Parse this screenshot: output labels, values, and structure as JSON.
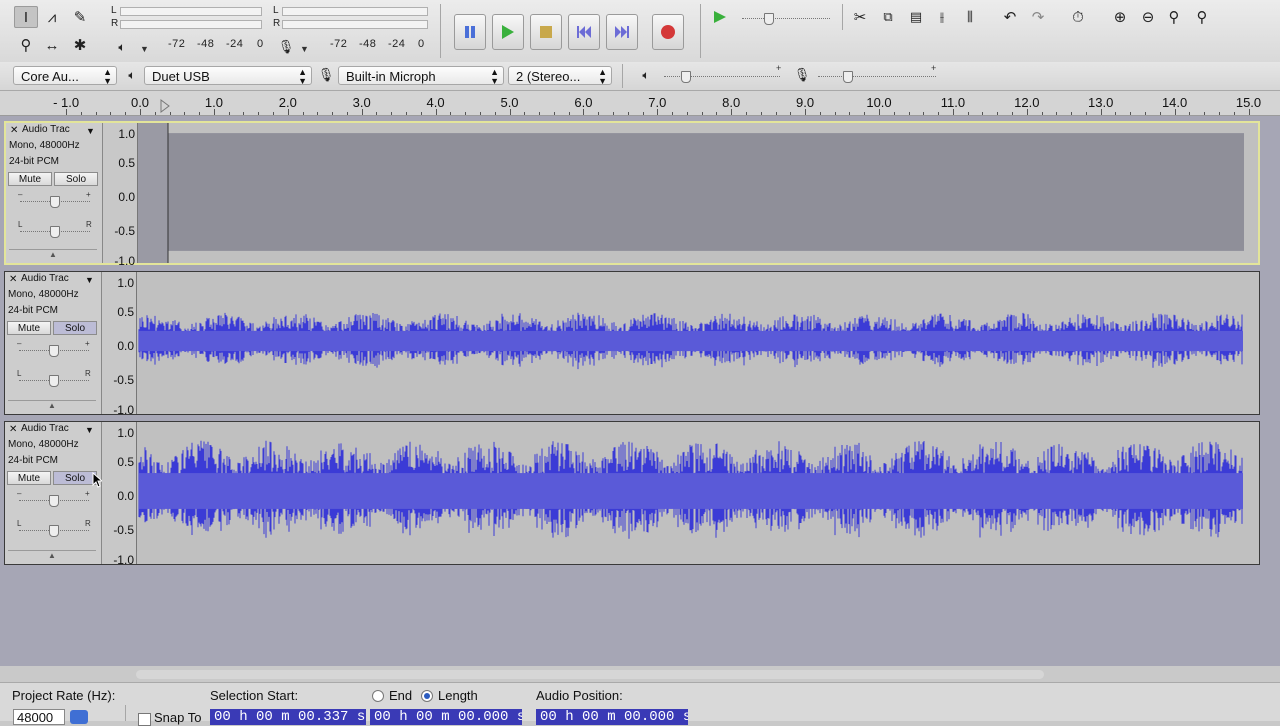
{
  "toolbar": {
    "tools": [
      {
        "name": "selection-tool-icon",
        "glyph": "I",
        "active": true
      },
      {
        "name": "envelope-tool-icon",
        "glyph": "⩘",
        "active": false
      },
      {
        "name": "draw-tool-icon",
        "glyph": "✎",
        "active": false
      },
      {
        "name": "zoom-tool-icon",
        "glyph": "⚲",
        "active": false
      },
      {
        "name": "timeshift-tool-icon",
        "glyph": "↔",
        "active": false
      },
      {
        "name": "multi-tool-icon",
        "glyph": "✱",
        "active": false
      }
    ],
    "play_meter": {
      "left_label": "L",
      "right_label": "R"
    },
    "record_meter": {
      "left_label": "L",
      "right_label": "R",
      "scale": [
        "-72",
        "-48",
        "-24",
        "0"
      ]
    },
    "meter_scale": [
      "-72",
      "-48",
      "-24",
      "0"
    ],
    "edit_icons": [
      "cut-icon",
      "copy-icon",
      "paste-icon",
      "trim-icon",
      "silence-icon",
      "undo-icon",
      "redo-icon",
      "sync-lock-icon",
      "zoom-in-icon",
      "zoom-out-icon",
      "fit-selection-icon",
      "fit-project-icon"
    ]
  },
  "transport": {
    "pause": "pause-icon",
    "play": "play-icon",
    "stop": "stop-icon",
    "skip_start": "skip-to-start-icon",
    "skip_end": "skip-to-end-icon",
    "record": "record-icon"
  },
  "device": {
    "host": "Core Au...",
    "output": "Duet USB",
    "input": "Built-in Microph",
    "channels": "2 (Stereo..."
  },
  "ruler": {
    "labels": [
      "- 1.0",
      "0.0",
      "1.0",
      "2.0",
      "3.0",
      "4.0",
      "5.0",
      "6.0",
      "7.0",
      "8.0",
      "9.0",
      "10.0",
      "11.0",
      "12.0",
      "13.0",
      "14.0",
      "15.0"
    ]
  },
  "tracks": [
    {
      "name": "Audio Trac",
      "format": "Mono, 48000Hz",
      "bits": "24-bit PCM",
      "mute": "Mute",
      "solo": "Solo",
      "solo_pressed": false,
      "selected": true,
      "amplitude": 0.92,
      "color": "#8f8f99",
      "scale": [
        "1.0",
        "0.5",
        "0.0",
        "-0.5",
        "-1.0"
      ]
    },
    {
      "name": "Audio Trac",
      "format": "Mono, 48000Hz",
      "bits": "24-bit PCM",
      "mute": "Mute",
      "solo": "Solo",
      "solo_pressed": true,
      "selected": false,
      "amplitude": 0.45,
      "color": "#3b3bd6",
      "scale": [
        "1.0",
        "0.5",
        "0.0",
        "-0.5",
        "-1.0"
      ]
    },
    {
      "name": "Audio Trac",
      "format": "Mono, 48000Hz",
      "bits": "24-bit PCM",
      "mute": "Mute",
      "solo": "Solo",
      "solo_pressed": true,
      "selected": false,
      "amplitude": 0.8,
      "color": "#3b3bd6",
      "scale": [
        "1.0",
        "0.5",
        "0.0",
        "-0.5",
        "-1.0"
      ]
    }
  ],
  "selection_bar": {
    "project_rate_label": "Project Rate (Hz):",
    "project_rate": "48000",
    "snap_to_label": "Snap To",
    "selection_start_label": "Selection Start:",
    "end_label": "End",
    "length_label": "Length",
    "start_value": "00 h 00 m 00.337 s",
    "length_value": "00 h 00 m 00.000 s",
    "audio_position_label": "Audio Position:",
    "audio_position_value": "00 h 00 m 00.000 s"
  }
}
